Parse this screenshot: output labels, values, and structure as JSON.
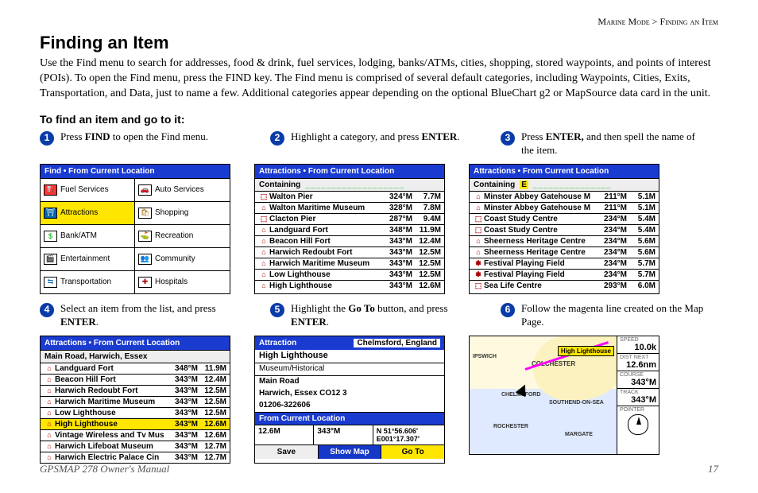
{
  "header": {
    "section": "Marine Mode",
    "topic": "Finding an Item"
  },
  "title": "Finding an Item",
  "intro": "Use the Find menu to search for addresses, food & drink, fuel services, lodging, banks/ATMs, cities, shopping, stored waypoints, and points of interest (POIs). To open the Find menu, press the FIND key. The Find menu is comprised of several default categories, including Waypoints, Cities, Exits, Transportation, and Data, just to name a few. Additional categories appear depending on the optional BlueChart g2 or MapSource data card in the unit.",
  "procedure_heading": "To find an item and go to it:",
  "steps": [
    {
      "num": "1",
      "key": "FIND",
      "text": "to open the Find menu."
    },
    {
      "num": "2",
      "text_a": "Highlight a category, and press",
      "key": "ENTER",
      "text_b": "."
    },
    {
      "num": "3",
      "key": "ENTER,",
      "text": " and then spell the name of the item."
    },
    {
      "num": "4",
      "text_a": "Select an item from the list, and press",
      "key": "ENTER",
      "text_b": "."
    },
    {
      "num": "5",
      "text_a": "Highlight the",
      "key1": "Go To",
      "text_b": "button, and press",
      "key2": "ENTER",
      "text_c": "."
    },
    {
      "num": "6",
      "text": "Follow the magenta line created on the Map Page."
    }
  ],
  "screen1": {
    "title": "Find • From Current Location",
    "cats": [
      "Fuel Services",
      "Auto Services",
      "Attractions",
      "Shopping",
      "Bank/ATM",
      "Recreation",
      "Entertainment",
      "Community",
      "Transportation",
      "Hospitals"
    ]
  },
  "screen2": {
    "title": "Attractions • From Current Location",
    "sublabel": "Containing",
    "cursor": "___________________",
    "rows": [
      {
        "sym": "⬚",
        "name": "Walton Pier",
        "brg": "324°M",
        "dist": "7.7M"
      },
      {
        "sym": "⌂",
        "name": "Walton Maritime Museum",
        "brg": "328°M",
        "dist": "7.8M"
      },
      {
        "sym": "⬚",
        "name": "Clacton Pier",
        "brg": "287°M",
        "dist": "9.4M"
      },
      {
        "sym": "⌂",
        "name": "Landguard Fort",
        "brg": "348°M",
        "dist": "11.9M"
      },
      {
        "sym": "⌂",
        "name": "Beacon Hill Fort",
        "brg": "343°M",
        "dist": "12.4M"
      },
      {
        "sym": "⌂",
        "name": "Harwich Redoubt Fort",
        "brg": "343°M",
        "dist": "12.5M"
      },
      {
        "sym": "⌂",
        "name": "Harwich Maritime Museum",
        "brg": "343°M",
        "dist": "12.5M"
      },
      {
        "sym": "⌂",
        "name": "Low Lighthouse",
        "brg": "343°M",
        "dist": "12.5M"
      },
      {
        "sym": "⌂",
        "name": "High Lighthouse",
        "brg": "343°M",
        "dist": "12.6M"
      }
    ]
  },
  "screen3": {
    "title": "Attractions • From Current Location",
    "sublabel": "Containing",
    "filter": "E",
    "cursor": "_______________",
    "rows": [
      {
        "sym": "⌂",
        "name": "Minster Abbey Gatehouse M",
        "brg": "211°M",
        "dist": "5.1M"
      },
      {
        "sym": "⌂",
        "name": "Minster Abbey Gatehouse M",
        "brg": "211°M",
        "dist": "5.1M"
      },
      {
        "sym": "⬚",
        "name": "Coast Study Centre",
        "brg": "234°M",
        "dist": "5.4M"
      },
      {
        "sym": "⬚",
        "name": "Coast Study Centre",
        "brg": "234°M",
        "dist": "5.4M"
      },
      {
        "sym": "⌂",
        "name": "Sheerness Heritage Centre",
        "brg": "234°M",
        "dist": "5.6M"
      },
      {
        "sym": "⌂",
        "name": "Sheerness Heritage Centre",
        "brg": "234°M",
        "dist": "5.6M"
      },
      {
        "sym": "✽",
        "name": "Festival Playing Field",
        "brg": "234°M",
        "dist": "5.7M"
      },
      {
        "sym": "✽",
        "name": "Festival Playing Field",
        "brg": "234°M",
        "dist": "5.7M"
      },
      {
        "sym": "⬚",
        "name": "Sea Life Centre",
        "brg": "293°M",
        "dist": "6.0M"
      }
    ]
  },
  "screen4": {
    "title": "Attractions • From Current Location",
    "subtitle": "Main Road, Harwich, Essex",
    "rows": [
      {
        "sym": "⌂",
        "name": "Landguard Fort",
        "brg": "348°M",
        "dist": "11.9M",
        "sel": false
      },
      {
        "sym": "⌂",
        "name": "Beacon Hill Fort",
        "brg": "343°M",
        "dist": "12.4M",
        "sel": false
      },
      {
        "sym": "⌂",
        "name": "Harwich Redoubt Fort",
        "brg": "343°M",
        "dist": "12.5M",
        "sel": false
      },
      {
        "sym": "⌂",
        "name": "Harwich Maritime Museum",
        "brg": "343°M",
        "dist": "12.5M",
        "sel": false
      },
      {
        "sym": "⌂",
        "name": "Low Lighthouse",
        "brg": "343°M",
        "dist": "12.5M",
        "sel": false
      },
      {
        "sym": "⌂",
        "name": "High Lighthouse",
        "brg": "343°M",
        "dist": "12.6M",
        "sel": true
      },
      {
        "sym": "⌂",
        "name": "Vintage Wireless and Tv Mus",
        "brg": "343°M",
        "dist": "12.6M",
        "sel": false
      },
      {
        "sym": "⌂",
        "name": "Harwich Lifeboat Museum",
        "brg": "343°M",
        "dist": "12.7M",
        "sel": false
      },
      {
        "sym": "⌂",
        "name": "Harwich Electric Palace Cin",
        "brg": "343°M",
        "dist": "12.7M",
        "sel": false
      }
    ]
  },
  "screen5": {
    "tab": "Attraction",
    "region": "Chelmsford, England",
    "name": "High Lighthouse",
    "category": "Museum/Historical",
    "addr1": "Main Road",
    "addr2": "Harwich, Essex CO12 3",
    "phone": "01206-322606",
    "from_label": "From Current Location",
    "from_dist": "12.6M",
    "from_bearing": "343°M",
    "coord1": "N 51°56.606'",
    "coord2": "E001°17.307'",
    "btn_save": "Save",
    "btn_map": "Show Map",
    "btn_goto": "Go To"
  },
  "screen6": {
    "dest": "High Lighthouse",
    "cities": [
      "IPSWICH",
      "COLCHESTER",
      "CHELMSFORD",
      "SOUTHEND-ON-SEA",
      "ROCHESTER",
      "MARGATE"
    ],
    "fields": [
      {
        "label": "SPEED",
        "value": "10.0k"
      },
      {
        "label": "DIST NEXT",
        "value": "12.6nm"
      },
      {
        "label": "COURSE",
        "value": "343°M"
      },
      {
        "label": "TRACK",
        "value": "343°M"
      },
      {
        "label": "POINTER",
        "value": ""
      }
    ]
  },
  "footer": {
    "manual": "GPSMAP 278 Owner's Manual",
    "page": "17"
  }
}
